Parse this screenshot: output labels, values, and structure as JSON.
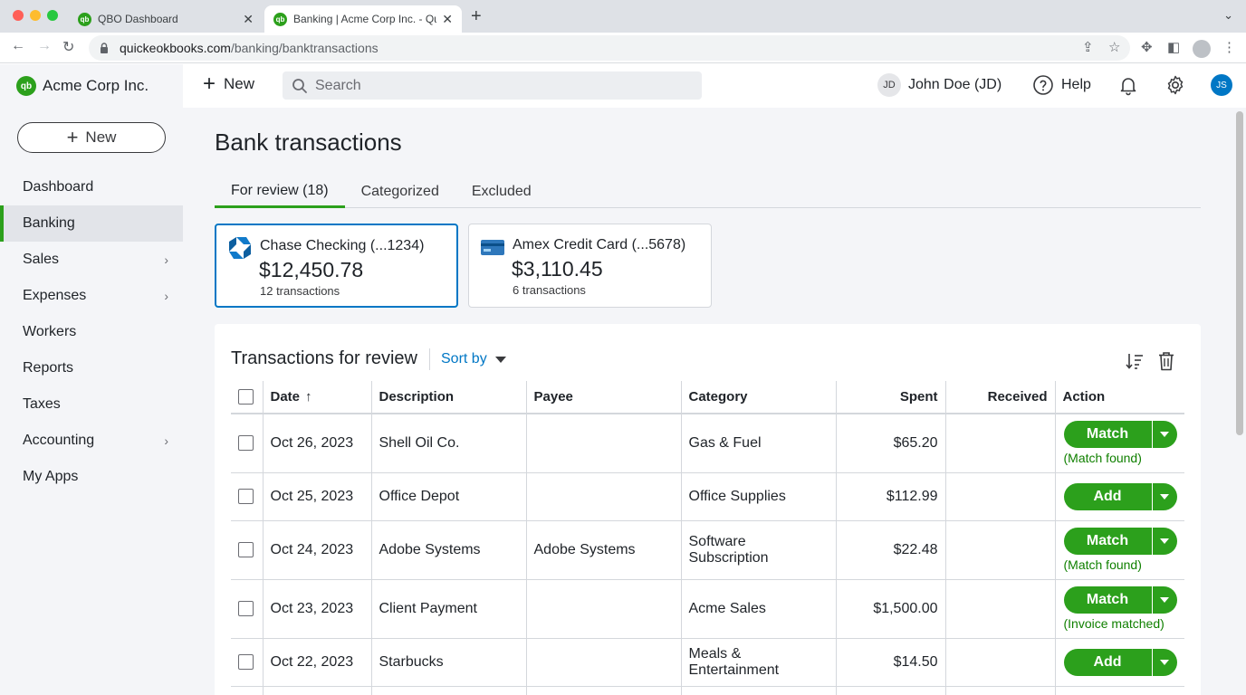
{
  "browser": {
    "tabs": [
      {
        "title": "QBO Dashboard"
      },
      {
        "title": "Banking | Acme Corp Inc. - Qui"
      }
    ],
    "url_host": "quickeokbooks.com",
    "url_path": "/banking/banktransactions"
  },
  "sidebar": {
    "company": "Acme Corp Inc.",
    "new_label": "New",
    "items": [
      {
        "label": "Dashboard"
      },
      {
        "label": "Banking"
      },
      {
        "label": "Sales"
      },
      {
        "label": "Expenses"
      },
      {
        "label": "Workers"
      },
      {
        "label": "Reports"
      },
      {
        "label": "Taxes"
      },
      {
        "label": "Accounting"
      },
      {
        "label": "My Apps"
      }
    ]
  },
  "topbar": {
    "new_label": "New",
    "search_placeholder": "Search",
    "user_initials": "JD",
    "user_name": "John Doe (JD)",
    "help_label": "Help",
    "avatar_initials": "JS"
  },
  "page": {
    "title": "Bank transactions",
    "tabs": [
      {
        "label": "For review (18)"
      },
      {
        "label": "Categorized"
      },
      {
        "label": "Excluded"
      }
    ]
  },
  "accounts": [
    {
      "name": "Chase Checking (...1234)",
      "balance": "$12,450.78",
      "count": "12 transactions"
    },
    {
      "name": "Amex Credit Card (...5678)",
      "balance": "$3,110.45",
      "count": "6 transactions"
    }
  ],
  "review": {
    "title": "Transactions for review",
    "sort_label": "Sort by",
    "columns": {
      "date": "Date",
      "date_arrow": "↑",
      "description": "Description",
      "payee": "Payee",
      "category": "Category",
      "spent": "Spent",
      "received": "Received",
      "action": "Action"
    },
    "rows": [
      {
        "date": "Oct 26, 2023",
        "description": "Shell Oil Co.",
        "payee": "",
        "category": "Gas & Fuel",
        "spent": "$65.20",
        "received": "",
        "action": "Match",
        "note": "(Match found)"
      },
      {
        "date": "Oct 25, 2023",
        "description": "Office Depot",
        "payee": "",
        "category": "Office Supplies",
        "spent": "$112.99",
        "received": "",
        "action": "Add",
        "note": ""
      },
      {
        "date": "Oct 24, 2023",
        "description": "Adobe Systems",
        "payee": "Adobe Systems",
        "category": "Software Subscription",
        "spent": "$22.48",
        "received": "",
        "action": "Match",
        "note": "(Match found)"
      },
      {
        "date": "Oct 23, 2023",
        "description": "Client Payment",
        "payee": "",
        "category": "Acme Sales",
        "spent": "$1,500.00",
        "received": "",
        "action": "Match",
        "note": "(Invoice matched)"
      },
      {
        "date": "Oct 22, 2023",
        "description": "Starbucks",
        "payee": "",
        "category": "Meals & Entertainment",
        "spent": "$14.50",
        "received": "",
        "action": "Add",
        "note": ""
      }
    ]
  },
  "colors": {
    "brand_green": "#2ca01c",
    "link_blue": "#0077c5",
    "note_green": "#108000"
  }
}
